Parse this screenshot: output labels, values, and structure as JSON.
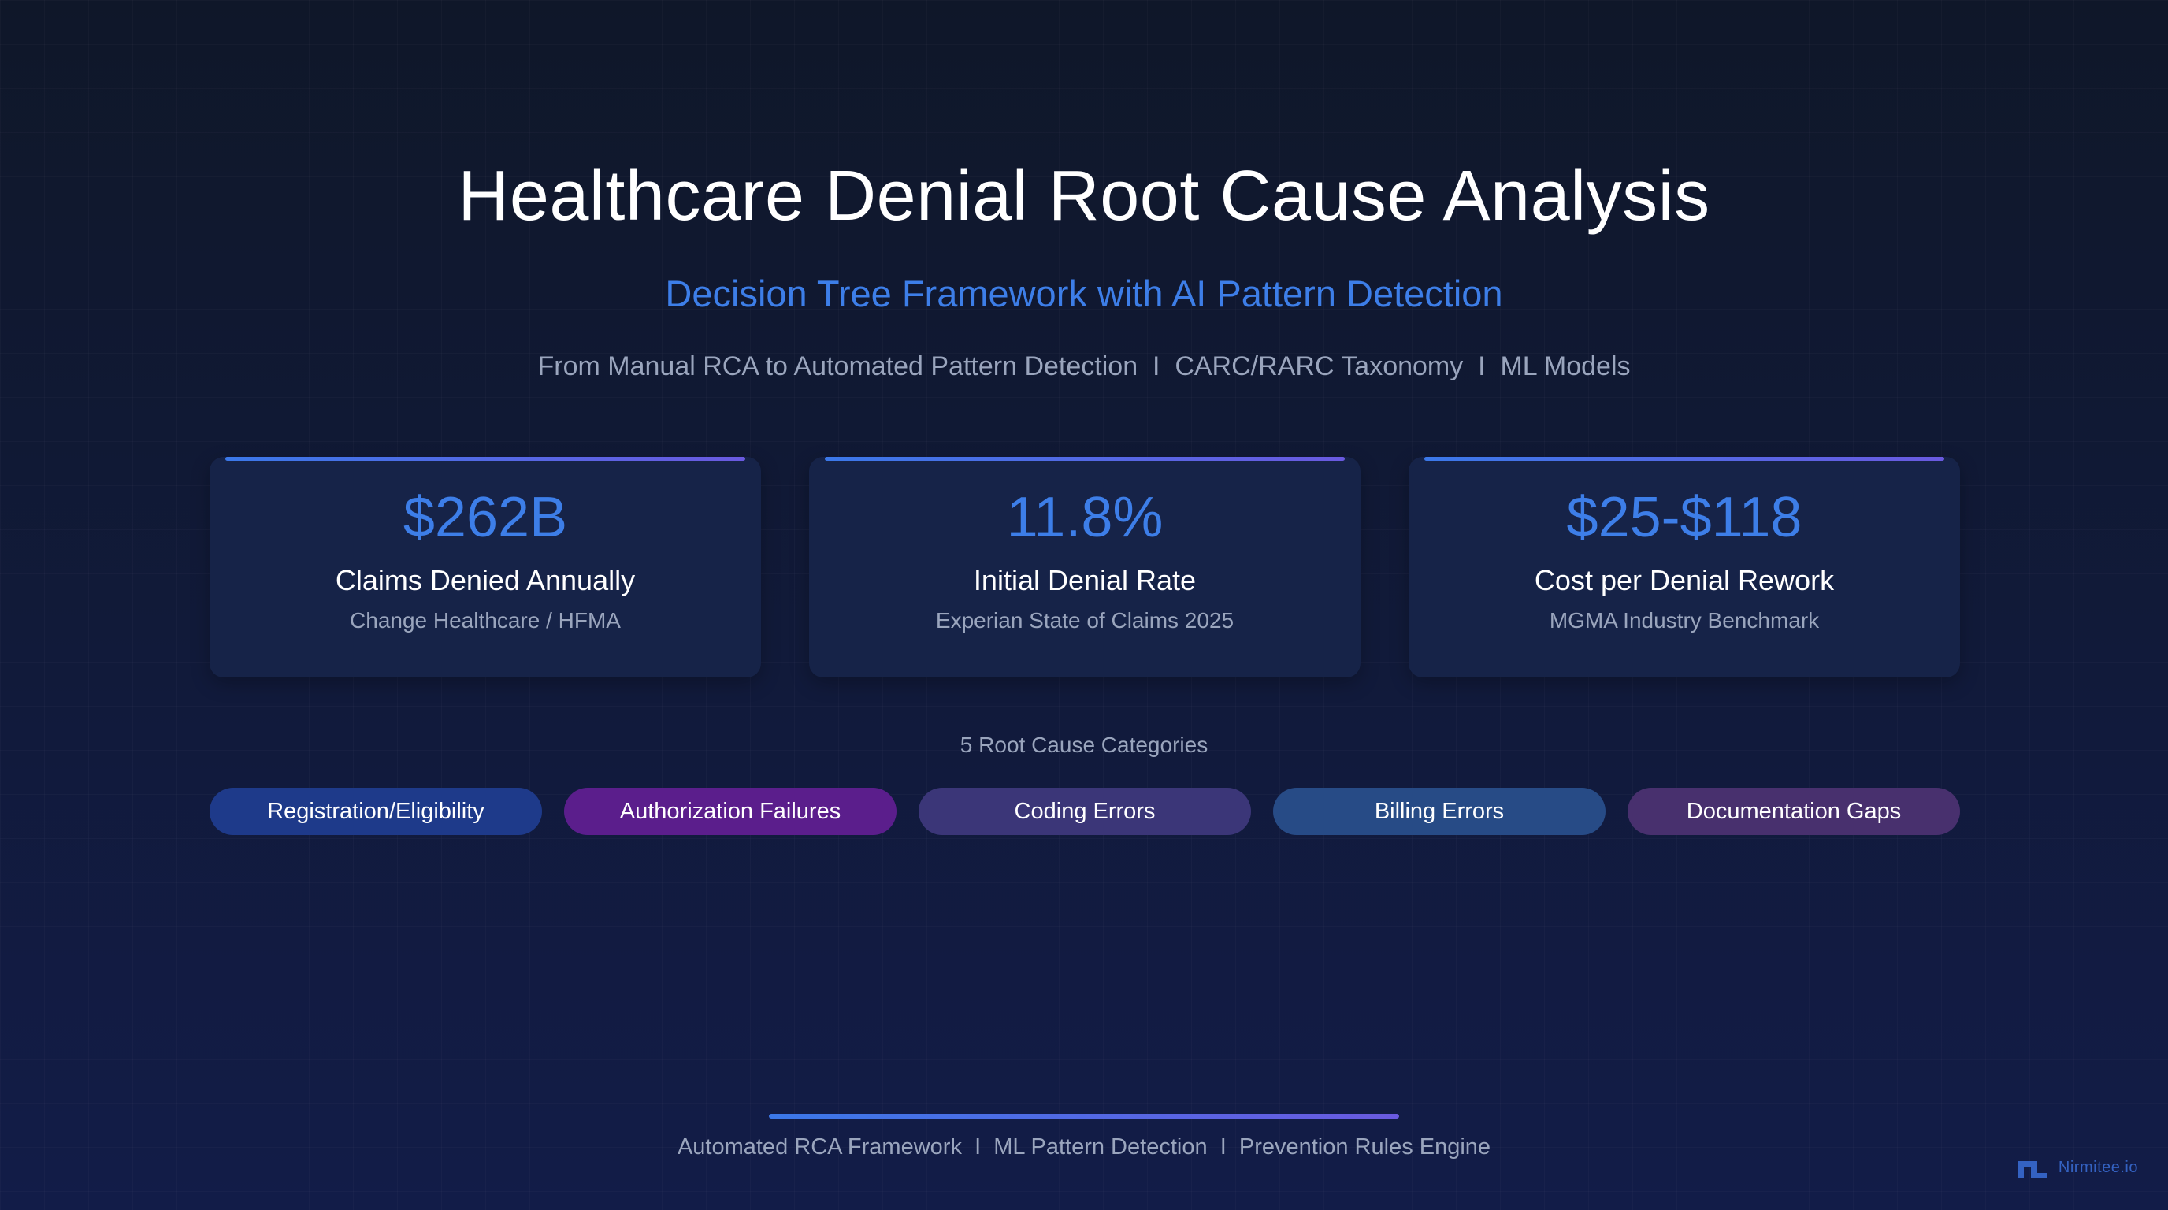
{
  "title": "Healthcare Denial Root Cause Analysis",
  "subtitle": "Decision Tree Framework with AI Pattern Detection",
  "tagline": "From Manual RCA to Automated Pattern Detection  I  CARC/RARC Taxonomy  I  ML Models",
  "stats": [
    {
      "value": "$262B",
      "label": "Claims Denied Annually",
      "source": "Change Healthcare / HFMA"
    },
    {
      "value": "11.8%",
      "label": "Initial Denial Rate",
      "source": "Experian State of Claims 2025"
    },
    {
      "value": "$25-$118",
      "label": "Cost per Denial Rework",
      "source": "MGMA Industry Benchmark"
    }
  ],
  "categories_label": "5 Root Cause Categories",
  "categories": [
    {
      "label": "Registration/Eligibility",
      "color": "#1e3a8a"
    },
    {
      "label": "Authorization Failures",
      "color": "#5b1e8c"
    },
    {
      "label": "Coding Errors",
      "color": "#3b3678"
    },
    {
      "label": "Billing Errors",
      "color": "#274b86"
    },
    {
      "label": "Documentation Gaps",
      "color": "#48306e"
    }
  ],
  "footer": "Automated RCA Framework  I  ML Pattern Detection  I  Prevention Rules Engine",
  "brand": {
    "name": "Nirmitee.io",
    "icon": "nirmitee-logo-icon"
  },
  "colors": {
    "accent": "#3d7ee8",
    "muted": "#9aa5bd",
    "card": "#162348"
  }
}
